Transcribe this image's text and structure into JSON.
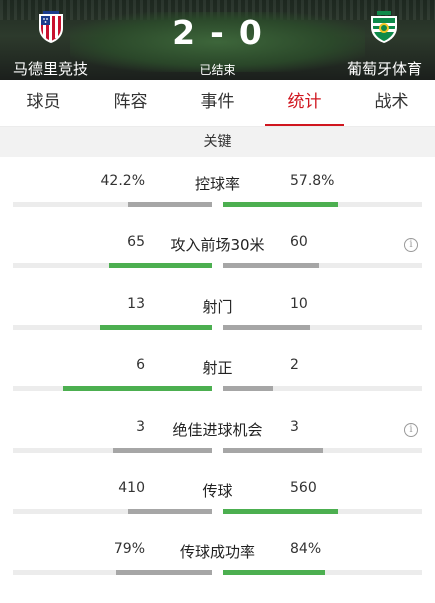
{
  "match": {
    "home_team": "马德里竞技",
    "away_team": "葡萄牙体育",
    "home_score": "2",
    "separator": "-",
    "away_score": "0",
    "status": "已结束",
    "home_crest_icon": "atletico-madrid-crest-icon",
    "away_crest_icon": "sporting-cp-crest-icon"
  },
  "tabs": [
    {
      "label": "球员",
      "active": false
    },
    {
      "label": "阵容",
      "active": false
    },
    {
      "label": "事件",
      "active": false
    },
    {
      "label": "统计",
      "active": true
    },
    {
      "label": "战术",
      "active": false
    }
  ],
  "section_title": "关键",
  "colors": {
    "accent": "#d0161f",
    "leading_bar": "#4caf50",
    "trailing_bar": "#a6a6a6",
    "track": "#ececec"
  },
  "stats": [
    {
      "label": "控球率",
      "home": "42.2%",
      "away": "57.8%",
      "home_share": 0.422,
      "away_share": 0.578,
      "info": false
    },
    {
      "label": "攻入前场30米",
      "home": "65",
      "away": "60",
      "home_share": 0.52,
      "away_share": 0.48,
      "info": true
    },
    {
      "label": "射门",
      "home": "13",
      "away": "10",
      "home_share": 0.565,
      "away_share": 0.435,
      "info": false
    },
    {
      "label": "射正",
      "home": "6",
      "away": "2",
      "home_share": 0.75,
      "away_share": 0.25,
      "info": false
    },
    {
      "label": "绝佳进球机会",
      "home": "3",
      "away": "3",
      "home_share": 0.5,
      "away_share": 0.5,
      "info": true
    },
    {
      "label": "传球",
      "home": "410",
      "away": "560",
      "home_share": 0.423,
      "away_share": 0.577,
      "info": false
    },
    {
      "label": "传球成功率",
      "home": "79%",
      "away": "84%",
      "home_share": 0.485,
      "away_share": 0.515,
      "info": false
    }
  ]
}
